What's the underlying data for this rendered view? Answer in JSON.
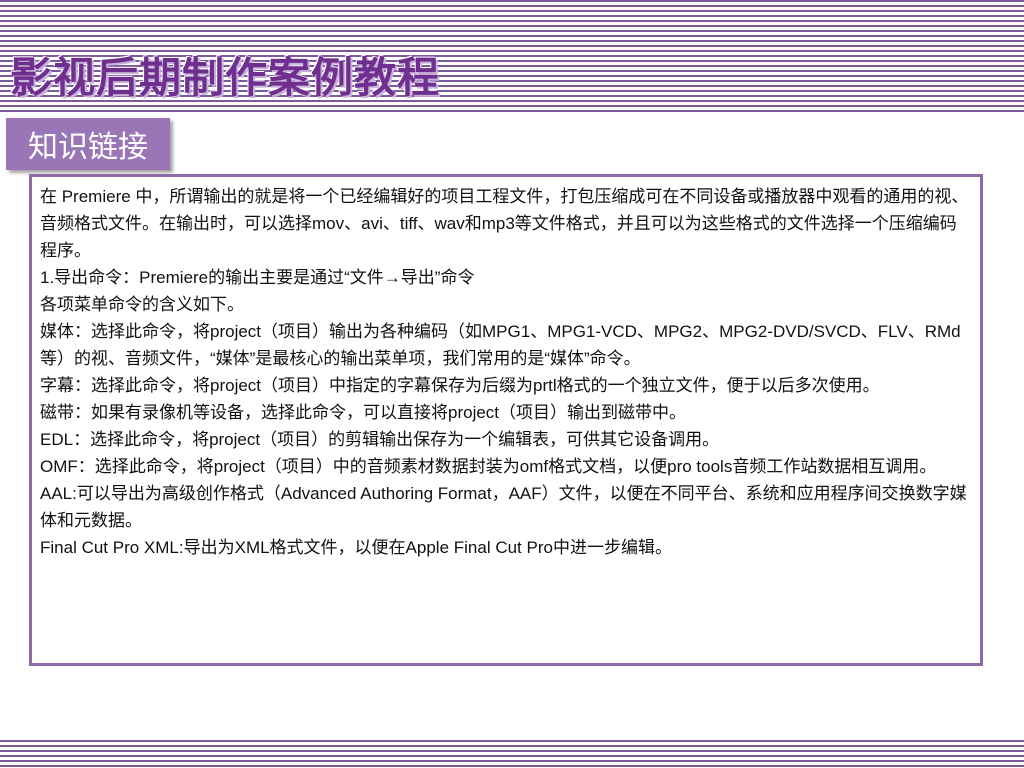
{
  "header": {
    "title": "影视后期制作案例教程"
  },
  "section": {
    "tag": "知识链接"
  },
  "content": {
    "paragraphs": [
      "在 Premiere 中，所谓输出的就是将一个已经编辑好的项目工程文件，打包压缩成可在不同设备或播放器中观看的通用的视、音频格式文件。在输出时，可以选择mov、avi、tiff、wav和mp3等文件格式，并且可以为这些格式的文件选择一个压缩编码程序。",
      "1.导出命令：Premiere的输出主要是通过“文件→导出”命令",
      "各项菜单命令的含义如下。",
      "媒体：选择此命令，将project（项目）输出为各种编码（如MPG1、MPG1-VCD、MPG2、MPG2-DVD/SVCD、FLV、RMd等）的视、音频文件，“媒体”是最核心的输出菜单项，我们常用的是“媒体”命令。",
      "字幕：选择此命令，将project（项目）中指定的字幕保存为后缀为prtl格式的一个独立文件，便于以后多次使用。",
      "磁带：如果有录像机等设备，选择此命令，可以直接将project（项目）输出到磁带中。",
      "EDL：选择此命令，将project（项目）的剪辑输出保存为一个编辑表，可供其它设备调用。",
      "OMF：选择此命令，将project（项目）中的音频素材数据封装为omf格式文档，以便pro tools音频工作站数据相互调用。",
      "AAL:可以导出为高级创作格式（Advanced Authoring Format，AAF）文件，以便在不同平台、系统和应用程序间交换数字媒体和元数据。",
      "Final Cut Pro XML:导出为XML格式文件，以便在Apple Final Cut Pro中进一步编辑。"
    ]
  },
  "colors": {
    "accent": "#6f2f8f",
    "stripe": "#7a5a9a",
    "tag_bg": "#9a76b6",
    "box_border": "#8d6aaa"
  }
}
